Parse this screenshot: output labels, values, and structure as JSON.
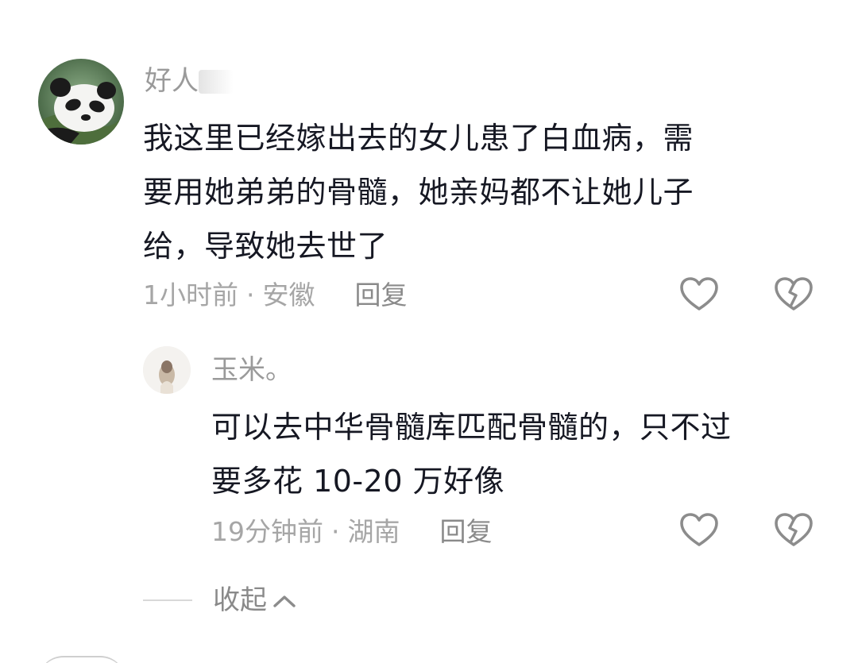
{
  "comments": [
    {
      "username": "好人",
      "text_lines": [
        "我这里已经嫁出去的女儿患了白血病，需",
        "要用她弟弟的骨髓，她亲妈都不让她儿子",
        "给，导致她去世了"
      ],
      "time": "1小时前",
      "location": "安徽",
      "separator": "·",
      "reply_label": "回复",
      "avatar_icon": "panda-avatar",
      "like_icon": "heart-outline-icon",
      "dislike_icon": "broken-heart-icon"
    }
  ],
  "reply": {
    "username": "玉米。",
    "text_lines": [
      "可以去中华骨髓库匹配骨髓的，只不过",
      "要多花 10-20 万好像"
    ],
    "time": "19分钟前",
    "location": "湖南",
    "separator": "·",
    "reply_label": "回复",
    "avatar_icon": "girl-avatar",
    "like_icon": "heart-outline-icon",
    "dislike_icon": "broken-heart-icon"
  },
  "collapse": {
    "label": "收起",
    "icon": "chevron-up-icon"
  },
  "colors": {
    "primary_text": "#161823",
    "meta_text": "#a6a6a6",
    "icon_stroke": "#8c8c8c"
  }
}
